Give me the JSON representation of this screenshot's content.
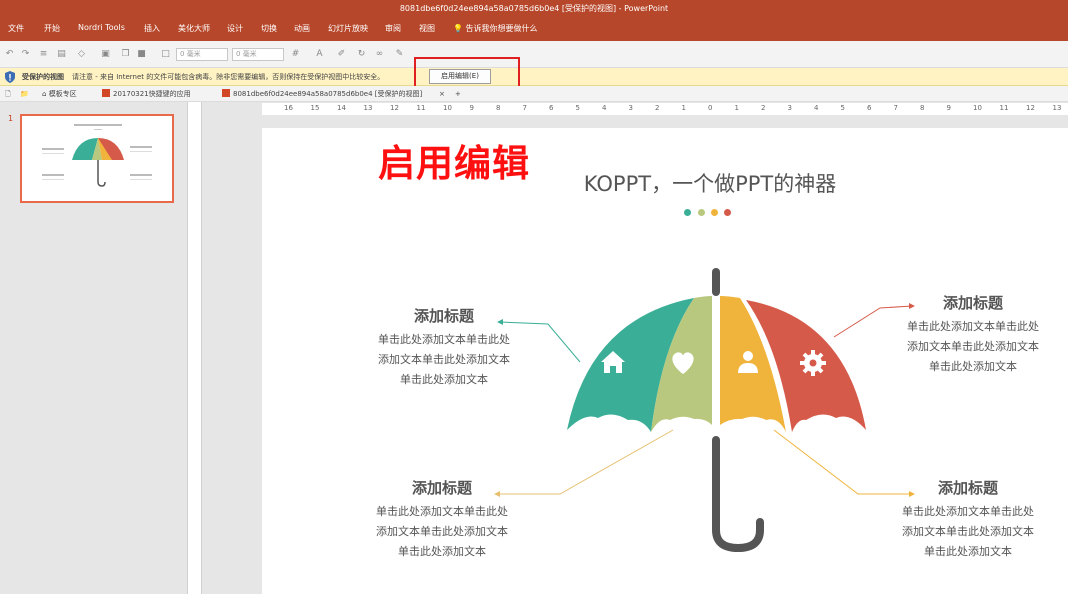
{
  "window": {
    "title": "8081dbe6f0d24ee894a58a0785d6b0e4 [受保护的视图] - PowerPoint"
  },
  "menu": {
    "items": [
      "文件",
      "开始",
      "Nordri Tools",
      "插入",
      "美化大师",
      "设计",
      "切换",
      "动画",
      "幻灯片放映",
      "审阅",
      "视图"
    ],
    "tellme": "告诉我你想要做什么"
  },
  "toolbar": {
    "font_size_a": "0 毫米",
    "font_size_b": "0 毫米"
  },
  "protected_bar": {
    "title": "受保护的视图",
    "message": "请注意 - 来自 Internet 的文件可能包含病毒。除非您需要编辑，否则保持在受保护视图中比较安全。",
    "enable_button": "启用编辑(E)"
  },
  "doc_tabs": {
    "templates": "模板专区",
    "tab1": "20170321快捷键的应用",
    "tab2": "8081dbe6f0d24ee894a58a0785d6b0e4 [受保护的视图]",
    "close": "×",
    "add": "+"
  },
  "thumbnail": {
    "number": "1"
  },
  "ruler": {
    "labels": [
      "16",
      "15",
      "14",
      "13",
      "12",
      "11",
      "10",
      "9",
      "8",
      "7",
      "6",
      "5",
      "4",
      "3",
      "2",
      "1",
      "0",
      "1",
      "2",
      "3",
      "4",
      "5",
      "6",
      "7",
      "8",
      "9",
      "10",
      "11",
      "12",
      "13"
    ]
  },
  "overlay": {
    "text": "启用编辑"
  },
  "slide": {
    "title": "KOPPT，一个做PPT的神器",
    "dot_colors": [
      "#3aae96",
      "#b8c97f",
      "#f0b43c",
      "#d65a4a"
    ],
    "items": [
      {
        "title": "添加标题",
        "lines": [
          "单击此处添加文本单击此处",
          "添加文本单击此处添加文本",
          "单击此处添加文本"
        ]
      },
      {
        "title": "添加标题",
        "lines": [
          "单击此处添加文本单击此处",
          "添加文本单击此处添加文本",
          "单击此处添加文本"
        ]
      },
      {
        "title": "添加标题",
        "lines": [
          "单击此处添加文本单击此处",
          "添加文本单击此处添加文本",
          "单击此处添加文本"
        ]
      },
      {
        "title": "添加标题",
        "lines": [
          "单击此处添加文本单击此处",
          "添加文本单击此处添加文本",
          "单击此处添加文本"
        ]
      }
    ],
    "colors": {
      "teal": "#3aae96",
      "green": "#b8c97f",
      "yellow": "#f0b43c",
      "red": "#d65a4a",
      "handle": "#555555"
    }
  }
}
